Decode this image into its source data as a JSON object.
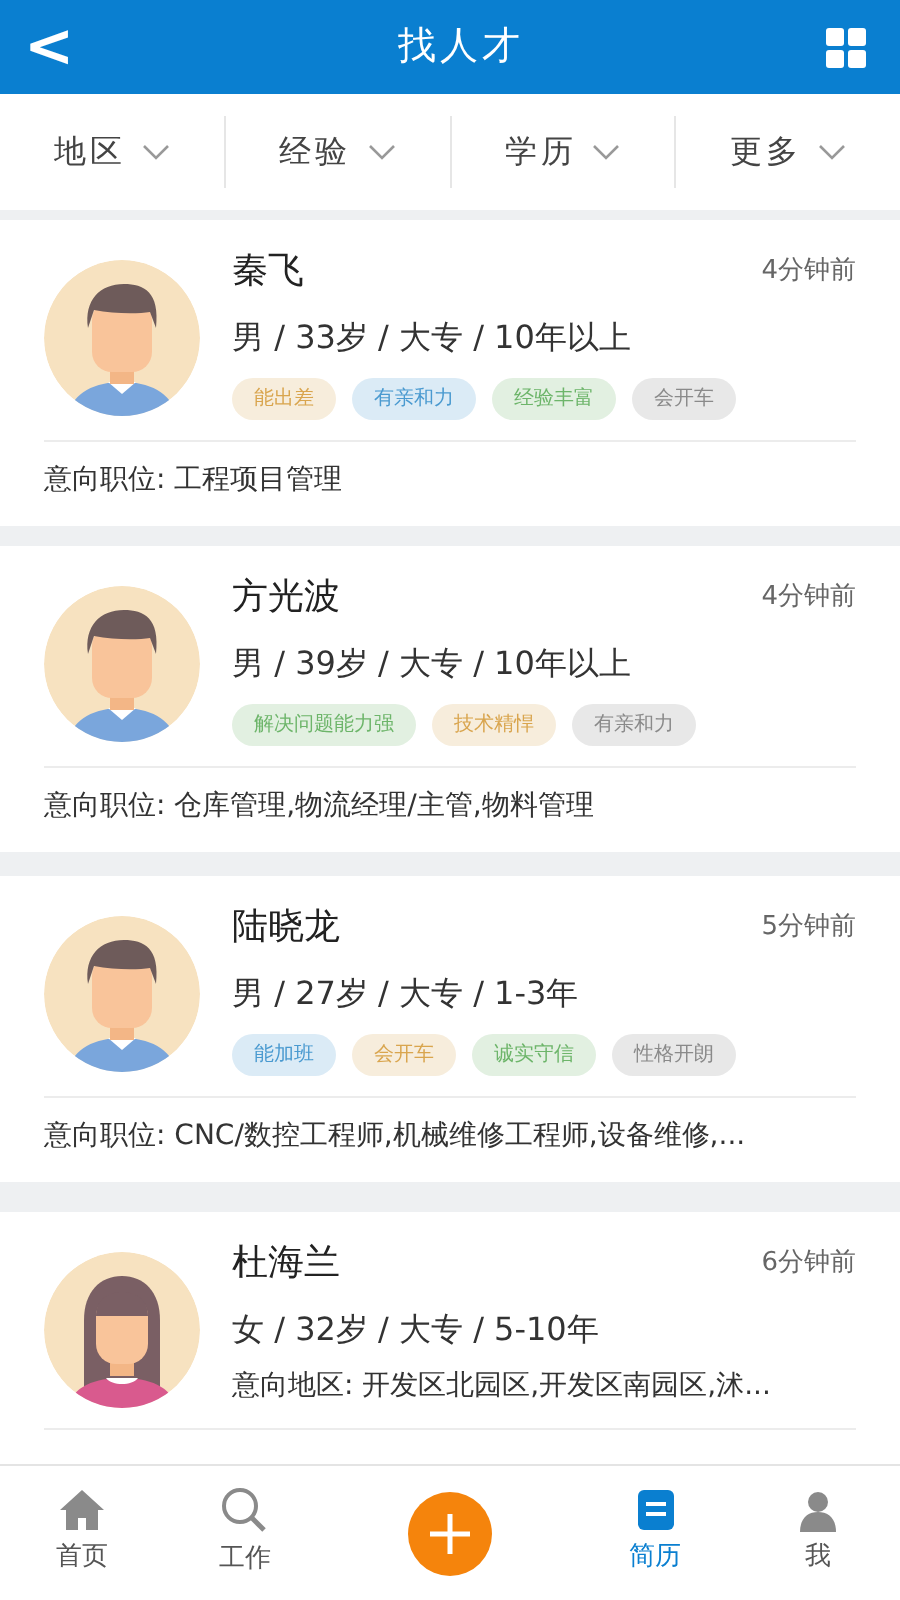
{
  "header": {
    "back": "<",
    "title": "找人才"
  },
  "filters": [
    {
      "label": "地区"
    },
    {
      "label": "经验"
    },
    {
      "label": "学历"
    },
    {
      "label": "更多"
    }
  ],
  "candidates": [
    {
      "kind": "male",
      "name": "秦飞",
      "time": "4分钟前",
      "info": "男 / 33岁 / 大专 / 10年以上",
      "tags": [
        {
          "label": "能出差",
          "color": "#d9a54e"
        },
        {
          "label": "有亲和力",
          "color": "#4a9ad0"
        },
        {
          "label": "经验丰富",
          "color": "#6db56a"
        },
        {
          "label": "会开车",
          "color": "#8a8a8a"
        }
      ],
      "footer": "意向职位: 工程项目管理"
    },
    {
      "kind": "male",
      "name": "方光波",
      "time": "4分钟前",
      "info": "男 / 39岁 / 大专 / 10年以上",
      "tags": [
        {
          "label": "解决问题能力强",
          "color": "#6db56a"
        },
        {
          "label": "技术精悍",
          "color": "#d9a54e"
        },
        {
          "label": "有亲和力",
          "color": "#8a8a8a"
        }
      ],
      "footer": "意向职位: 仓库管理,物流经理/主管,物料管理"
    },
    {
      "kind": "male",
      "name": "陆晓龙",
      "time": "5分钟前",
      "info": "男 / 27岁 / 大专 / 1-3年",
      "tags": [
        {
          "label": "能加班",
          "color": "#4a9ad0"
        },
        {
          "label": "会开车",
          "color": "#d9a54e"
        },
        {
          "label": "诚实守信",
          "color": "#6db56a"
        },
        {
          "label": "性格开朗",
          "color": "#8a8a8a"
        }
      ],
      "footer": "意向职位: CNC/数控工程师,机械维修工程师,设备维修,..."
    },
    {
      "kind": "female",
      "name": "杜海兰",
      "time": "6分钟前",
      "info": "女 / 32岁 / 大专 / 5-10年",
      "area": "意向地区: 开发区北园区,开发区南园区,沭..."
    }
  ],
  "nav": [
    {
      "kind": "home",
      "label": "首页",
      "selected": false
    },
    {
      "kind": "search",
      "label": "工作",
      "selected": false
    },
    {
      "kind": "plus",
      "selected": false
    },
    {
      "kind": "resume",
      "label": "简历",
      "selected": true
    },
    {
      "kind": "me",
      "label": "我",
      "selected": false
    }
  ]
}
